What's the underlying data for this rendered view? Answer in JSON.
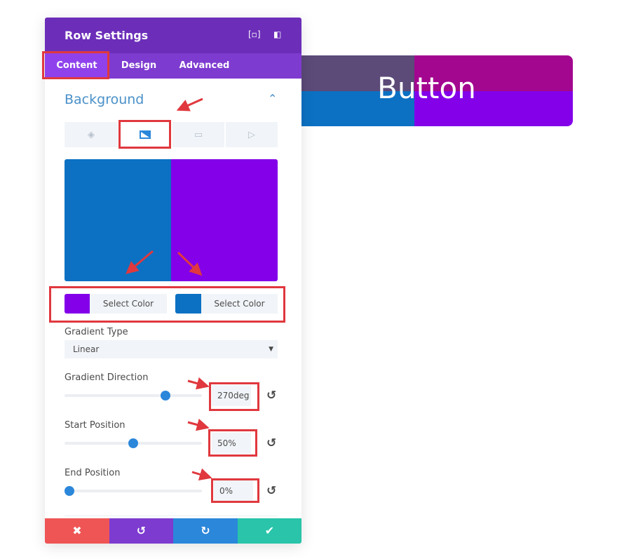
{
  "preview_button": {
    "label": "Button",
    "colors": {
      "top_left": "#5c4a78",
      "top_right": "#a3068f",
      "bottom_left": "#0c71c3",
      "bottom_right": "#8300e9"
    }
  },
  "panel": {
    "title": "Row Settings",
    "header_icons": [
      "fullscreen-icon",
      "split-view-icon"
    ],
    "tabs": [
      {
        "label": "Content",
        "active": true
      },
      {
        "label": "Design"
      },
      {
        "label": "Advanced"
      }
    ],
    "section": {
      "title": "Background",
      "expanded": true
    },
    "bg_type_tabs": [
      {
        "icon": "paint-bucket-icon"
      },
      {
        "icon": "gradient-icon",
        "active": true
      },
      {
        "icon": "image-icon"
      },
      {
        "icon": "video-icon"
      }
    ],
    "gradient_preview": {
      "left": "#0c71c3",
      "right": "#8300e9"
    },
    "color_pickers": [
      {
        "color": "#8300e9",
        "label": "Select Color"
      },
      {
        "color": "#0c71c3",
        "label": "Select Color"
      }
    ],
    "gradient_type": {
      "label": "Gradient Type",
      "value": "Linear"
    },
    "gradient_direction": {
      "label": "Gradient Direction",
      "value": "270deg",
      "slider_fraction": 0.75
    },
    "start_position": {
      "label": "Start Position",
      "value": "50%",
      "slider_fraction": 0.5
    },
    "end_position": {
      "label": "End Position",
      "value": "0%",
      "slider_fraction": 0
    },
    "footer": {
      "cancel": "✖",
      "undo": "↺",
      "redo": "↻",
      "save": "✔"
    },
    "colors": {
      "header": "#6c2eb9",
      "tabs": "#7e3bd0",
      "accent": "#2b87da",
      "cancel": "#ef5555",
      "undo": "#7d3bcf",
      "redo": "#2b87da",
      "save": "#29c4a9",
      "annotation": "#e0383e"
    }
  }
}
